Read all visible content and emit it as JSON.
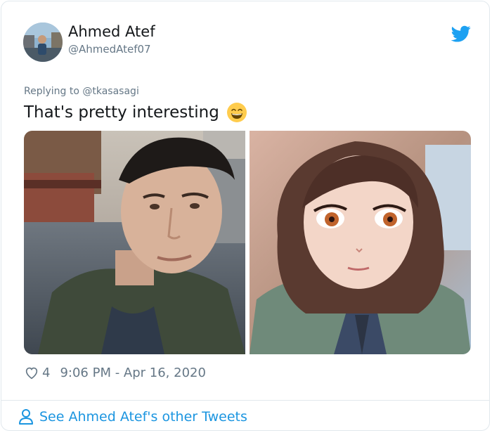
{
  "author": {
    "display_name": "Ahmed Atef",
    "handle": "@AhmedAtef07"
  },
  "reply_context": "Replying to @tkasasagi",
  "tweet": {
    "text": "That's pretty interesting",
    "emoji": "grinning-face-with-smiling-eyes"
  },
  "media": [
    {
      "label": "selfie-photo"
    },
    {
      "label": "anime-style-portrait"
    }
  ],
  "meta": {
    "like_count": "4",
    "timestamp": "9:06 PM - Apr 16, 2020"
  },
  "footer": {
    "link_label": "See Ahmed Atef's other Tweets"
  },
  "colors": {
    "twitter_blue": "#1da1f2",
    "link_blue": "#1b95e0",
    "secondary_text": "#657786",
    "border": "#e1e8ed"
  }
}
